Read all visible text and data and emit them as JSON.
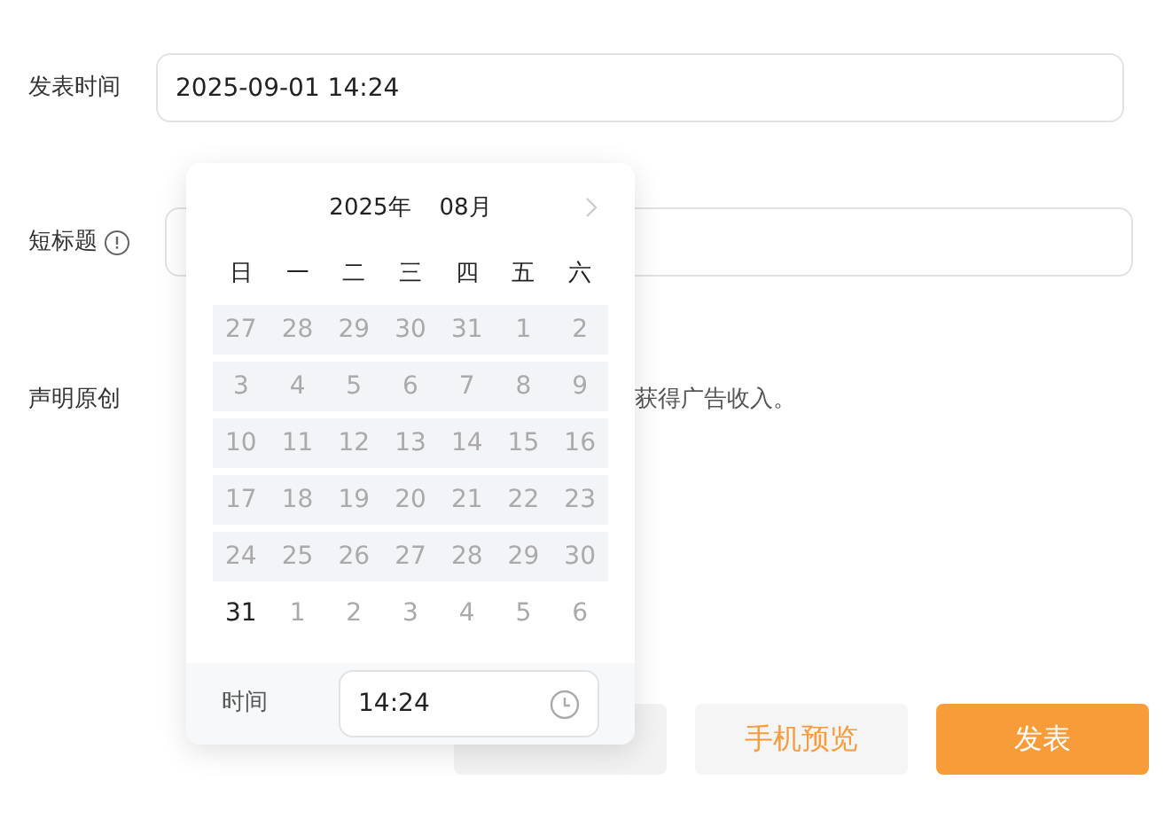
{
  "form": [
    {
      "label": "发表时间",
      "kind": "input",
      "value": "2025-09-01 14:24"
    },
    {
      "label": "短标题",
      "kind": "input_info"
    },
    {
      "label": "声明原创",
      "kind": "note",
      "note": "获得广告收入。"
    }
  ],
  "buttons": [
    {
      "kind": "draft"
    },
    {
      "label": "手机预览",
      "kind": "secondary"
    },
    {
      "label": "发表",
      "kind": "primary"
    }
  ],
  "date_picker": {
    "year": "2025年",
    "month": "08月",
    "weekdays": [
      "日",
      "一",
      "二",
      "三",
      "四",
      "五",
      "六"
    ],
    "weeks": [
      {
        "disabled": true,
        "days": [
          {
            "label": "27",
            "muted": true
          },
          {
            "label": "28",
            "muted": true
          },
          {
            "label": "29",
            "muted": true
          },
          {
            "label": "30",
            "muted": true
          },
          {
            "label": "31",
            "muted": true
          },
          {
            "label": "1",
            "muted": true
          },
          {
            "label": "2",
            "muted": true
          }
        ]
      },
      {
        "disabled": true,
        "days": [
          {
            "label": "3",
            "muted": true
          },
          {
            "label": "4",
            "muted": true
          },
          {
            "label": "5",
            "muted": true
          },
          {
            "label": "6",
            "muted": true
          },
          {
            "label": "7",
            "muted": true
          },
          {
            "label": "8",
            "muted": true
          },
          {
            "label": "9",
            "muted": true
          }
        ]
      },
      {
        "disabled": true,
        "days": [
          {
            "label": "10",
            "muted": true
          },
          {
            "label": "11",
            "muted": true
          },
          {
            "label": "12",
            "muted": true
          },
          {
            "label": "13",
            "muted": true
          },
          {
            "label": "14",
            "muted": true
          },
          {
            "label": "15",
            "muted": true
          },
          {
            "label": "16",
            "muted": true
          }
        ]
      },
      {
        "disabled": true,
        "days": [
          {
            "label": "17",
            "muted": true
          },
          {
            "label": "18",
            "muted": true
          },
          {
            "label": "19",
            "muted": true
          },
          {
            "label": "20",
            "muted": true
          },
          {
            "label": "21",
            "muted": true
          },
          {
            "label": "22",
            "muted": true
          },
          {
            "label": "23",
            "muted": true
          }
        ]
      },
      {
        "disabled": true,
        "days": [
          {
            "label": "24",
            "muted": true
          },
          {
            "label": "25",
            "muted": true
          },
          {
            "label": "26",
            "muted": true
          },
          {
            "label": "27",
            "muted": true
          },
          {
            "label": "28",
            "muted": true
          },
          {
            "label": "29",
            "muted": true
          },
          {
            "label": "30",
            "muted": true
          }
        ]
      },
      {
        "disabled": false,
        "days": [
          {
            "label": "31",
            "muted": false
          },
          {
            "label": "1",
            "muted": true
          },
          {
            "label": "2",
            "muted": true
          },
          {
            "label": "3",
            "muted": true
          },
          {
            "label": "4",
            "muted": true
          },
          {
            "label": "5",
            "muted": true
          },
          {
            "label": "6",
            "muted": true
          }
        ]
      }
    ],
    "time_label": "时间",
    "time_value": "14:24"
  }
}
